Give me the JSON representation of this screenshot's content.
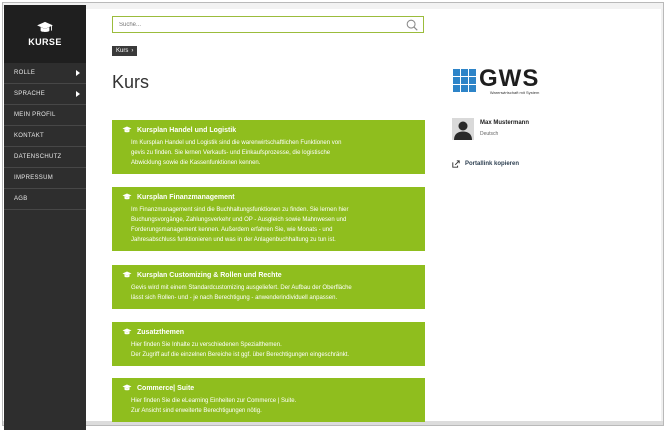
{
  "sidebar": {
    "brand": "KURSE",
    "items": [
      {
        "label": "ROLLE",
        "has_submenu": true
      },
      {
        "label": "SPRACHE",
        "has_submenu": true
      },
      {
        "label": "MEIN PROFIL",
        "has_submenu": false
      },
      {
        "label": "KONTAKT",
        "has_submenu": false
      },
      {
        "label": "DATENSCHUTZ",
        "has_submenu": false
      },
      {
        "label": "IMPRESSUM",
        "has_submenu": false
      },
      {
        "label": "AGB",
        "has_submenu": false
      }
    ]
  },
  "search": {
    "placeholder": "Suche..."
  },
  "breadcrumb": {
    "label": "Kurs",
    "chevron": "›"
  },
  "page": {
    "title": "Kurs"
  },
  "cards": [
    {
      "title": "Kursplan Handel und Logistik",
      "lines": [
        "Im Kursplan Handel und Logistik sind die warenwirtschaftlichen Funktionen von",
        "gevis zu finden. Sie lernen Verkaufs- und Einkaufsprozesse, die logistische",
        "Abwicklung sowie die Kassenfunktionen kennen."
      ]
    },
    {
      "title": "Kursplan Finanzmanagement",
      "lines": [
        "Im Finanzmanagement sind die Buchhaltungsfunktionen zu finden. Sie lernen hier",
        "Buchungsvorgänge, Zahlungsverkehr und OP - Ausgleich sowie Mahnwesen und",
        "Forderungsmanagement kennen. Außerdem erfahren Sie, wie Monats - und",
        "Jahresabschluss funktionieren und was in der Anlagenbuchhaltung zu tun ist."
      ]
    },
    {
      "title": "Kursplan Customizing & Rollen und Rechte",
      "lines": [
        "Gevis wird mit einem Standardcustomizing ausgeliefert. Der Aufbau der Oberfläche",
        "lässt sich Rollen- und - je nach Berechtigung - anwenderindividuell anpassen."
      ]
    },
    {
      "title": "Zusatzthemen",
      "lines": [
        "Hier finden Sie Inhalte zu verschiedenen Spezialthemen.",
        "Der Zugriff auf die einzelnen Bereiche ist ggf. über Berechtigungen eingeschränkt."
      ]
    },
    {
      "title": "Commerce| Suite",
      "lines": [
        "Hier finden Sie die eLearning Einheiten zur Commerce | Suite.",
        "Zur Ansicht sind erweiterte Berechtigungen nötig."
      ]
    }
  ],
  "logo": {
    "word": "GWS",
    "tagline": "Warenwirtschaft mit System"
  },
  "profile": {
    "name": "Max Mustermann",
    "language": "Deutsch"
  },
  "portal": {
    "label": "Portallink kopieren"
  },
  "colors": {
    "accent_green": "#8fbe1e",
    "sidebar": "#2e2e2e",
    "logo_blue": "#2d84c8"
  }
}
